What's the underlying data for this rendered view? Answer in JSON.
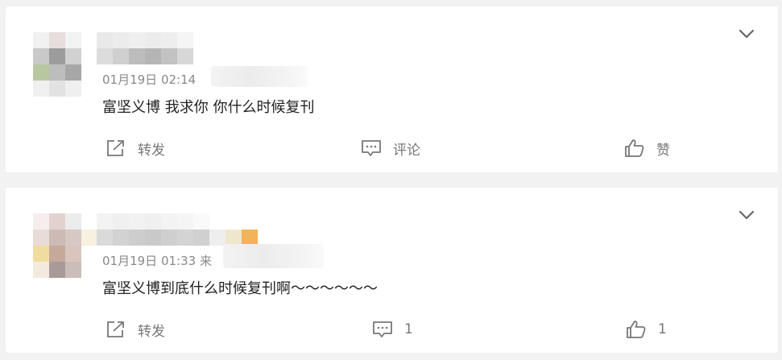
{
  "comments": [
    {
      "timestamp": "01月19日 02:14",
      "text": "富坚义博 我求你 你什么时候复刊",
      "actions": {
        "repost": "转发",
        "comment": "评论",
        "like": "赞"
      }
    },
    {
      "timestamp": "01月19日 01:33 来",
      "text": "富坚义博到底什么时候复刊啊～～～～～～",
      "actions": {
        "repost": "转发",
        "comment": "1",
        "like": "1"
      }
    }
  ],
  "icons": {
    "expand": "chevron-down-icon",
    "repost": "share-icon",
    "comment": "comment-icon",
    "like": "thumbs-up-icon"
  }
}
